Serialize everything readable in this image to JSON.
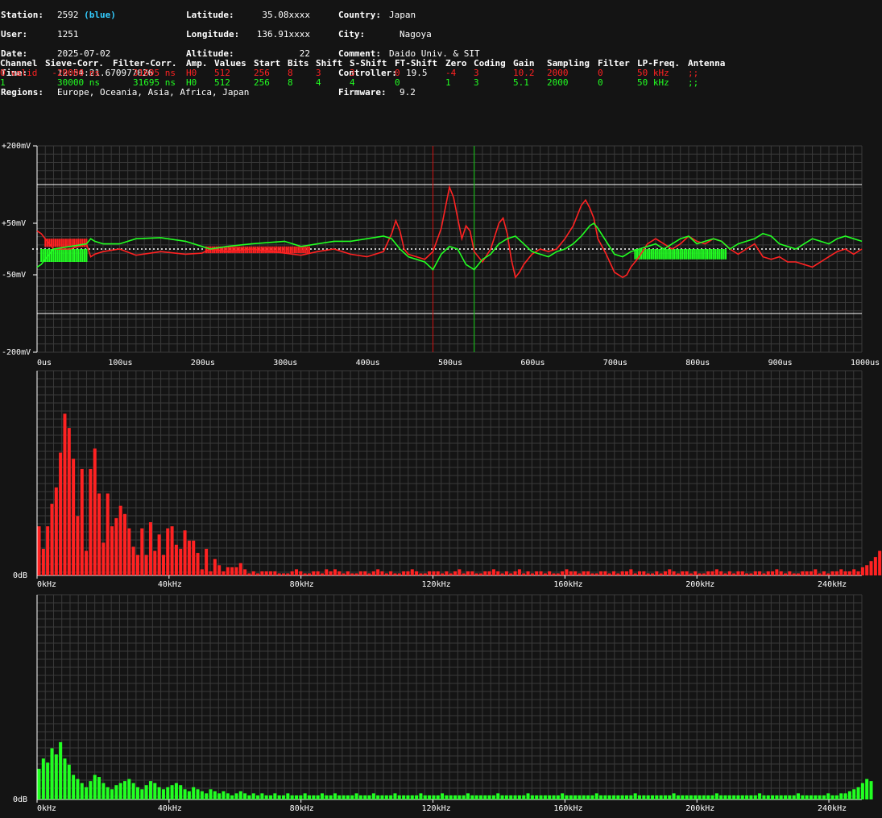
{
  "station_info": {
    "station_label": "Station:",
    "station": "2592",
    "station_color_name": "(blue)",
    "user_label": "User:",
    "user": "1251",
    "date_label": "Date:",
    "date": "2025-07-02",
    "time_label": "Time:",
    "time": "12:54:21.670977026",
    "regions_label": "Regions:",
    "regions": "Europe, Oceania, Asia, Africa, Japan",
    "latitude_label": "Latitude:",
    "latitude": "35.08xxxx",
    "longitude_label": "Longitude:",
    "longitude": "136.91xxxx",
    "altitude_label": "Altitude:",
    "altitude": "22",
    "country_label": "Country:",
    "country": "Japan",
    "city_label": "City:",
    "city": "Nagoya",
    "comment_label": "Comment:",
    "comment": "Daido Univ. & SIT",
    "controller_label": "Controller:",
    "controller": "19.5",
    "firmware_label": "Firmware:",
    "firmware": "9.2"
  },
  "channel_table": {
    "headers": [
      "Channel",
      "Sieve-Corr.",
      "Filter-Corr.",
      "Amp.",
      "Values",
      "Start",
      "Bits",
      "Shift",
      "S-Shift",
      "FT-Shift",
      "Zero",
      "Coding",
      "Gain",
      "Sampling",
      "Filter",
      "LP-Freq.",
      "Antenna"
    ],
    "rows": [
      [
        "0 valid",
        "-20000 ns",
        "31695 ns",
        "H0",
        "512",
        "256",
        "8",
        "3",
        "3",
        "0",
        "-4",
        "3",
        "10.2",
        "2000",
        "0",
        "50 kHz",
        ";;"
      ],
      [
        "1",
        "30000 ns",
        "31695 ns",
        "H0",
        "512",
        "256",
        "8",
        "4",
        "4",
        "0",
        "1",
        "3",
        "5.1",
        "2000",
        "0",
        "50 kHz",
        ";;"
      ]
    ],
    "row_colors": [
      "#ff2222",
      "#22ff22"
    ]
  },
  "chart_data": [
    {
      "type": "line",
      "xlim": [
        0,
        1000
      ],
      "ylim": [
        -200,
        200
      ],
      "y_tick_labels": [
        "+200mV",
        "+50mV",
        "-50mV",
        "-200mV"
      ],
      "y_tick_values": [
        200,
        50,
        -50,
        -200
      ],
      "x_tick_labels": [
        "0us",
        "100us",
        "200us",
        "300us",
        "400us",
        "500us",
        "600us",
        "700us",
        "800us",
        "900us",
        "1000us"
      ],
      "x_tick_values": [
        0,
        100,
        200,
        300,
        400,
        500,
        600,
        700,
        800,
        900,
        1000
      ],
      "reference_lines_mV": [
        125,
        -125
      ],
      "markers": [
        {
          "x": 480,
          "color": "#cc1111"
        },
        {
          "x": 530,
          "color": "#11cc11"
        }
      ],
      "series": [
        {
          "color": "#ff2222",
          "x": [
            0,
            5,
            10,
            20,
            40,
            60,
            65,
            70,
            80,
            100,
            120,
            150,
            180,
            200,
            210,
            230,
            260,
            300,
            320,
            340,
            360,
            380,
            400,
            420,
            430,
            435,
            440,
            445,
            450,
            460,
            470,
            480,
            490,
            500,
            505,
            510,
            515,
            520,
            525,
            530,
            540,
            550,
            560,
            565,
            570,
            575,
            580,
            585,
            590,
            600,
            610,
            620,
            630,
            640,
            650,
            660,
            665,
            670,
            675,
            680,
            690,
            700,
            710,
            715,
            720,
            730,
            740,
            750,
            760,
            770,
            780,
            790,
            800,
            810,
            820,
            830,
            840,
            850,
            860,
            870,
            880,
            890,
            900,
            910,
            920,
            930,
            940,
            950,
            960,
            970,
            980,
            990,
            1000
          ],
          "y": [
            35,
            30,
            20,
            0,
            0,
            10,
            -15,
            -10,
            -5,
            0,
            -12,
            -5,
            -10,
            -8,
            0,
            -5,
            0,
            -8,
            -12,
            -5,
            0,
            -10,
            -15,
            -5,
            30,
            55,
            35,
            0,
            -10,
            -15,
            -20,
            -5,
            40,
            120,
            100,
            60,
            20,
            45,
            35,
            -5,
            -25,
            0,
            50,
            60,
            30,
            -20,
            -55,
            -45,
            -30,
            -10,
            0,
            -5,
            0,
            20,
            45,
            85,
            95,
            80,
            60,
            20,
            -10,
            -45,
            -55,
            -50,
            -35,
            -15,
            10,
            20,
            10,
            0,
            10,
            25,
            15,
            10,
            20,
            15,
            0,
            -10,
            0,
            10,
            -15,
            -20,
            -15,
            -25,
            -25,
            -30,
            -35,
            -25,
            -15,
            -5,
            0,
            -10,
            0
          ]
        },
        {
          "color": "#22ff22",
          "x": [
            0,
            5,
            10,
            20,
            40,
            60,
            65,
            70,
            80,
            100,
            120,
            150,
            180,
            200,
            210,
            230,
            260,
            300,
            320,
            340,
            360,
            380,
            400,
            420,
            430,
            440,
            450,
            460,
            470,
            480,
            490,
            500,
            510,
            520,
            530,
            540,
            550,
            560,
            570,
            580,
            590,
            600,
            610,
            620,
            630,
            640,
            650,
            660,
            670,
            675,
            680,
            690,
            700,
            710,
            720,
            730,
            740,
            750,
            760,
            770,
            780,
            790,
            800,
            810,
            820,
            830,
            840,
            850,
            860,
            870,
            880,
            890,
            900,
            910,
            920,
            930,
            940,
            950,
            960,
            970,
            980,
            990,
            1000
          ],
          "y": [
            -35,
            -30,
            -20,
            0,
            5,
            10,
            20,
            15,
            10,
            10,
            20,
            22,
            15,
            5,
            0,
            5,
            10,
            15,
            5,
            10,
            15,
            15,
            20,
            25,
            20,
            0,
            -15,
            -20,
            -25,
            -40,
            -10,
            5,
            0,
            -30,
            -40,
            -20,
            -10,
            10,
            20,
            25,
            10,
            -5,
            -10,
            -15,
            -5,
            0,
            10,
            25,
            45,
            50,
            40,
            15,
            -10,
            -15,
            -5,
            0,
            5,
            10,
            0,
            10,
            20,
            25,
            10,
            15,
            20,
            15,
            0,
            10,
            15,
            20,
            30,
            25,
            10,
            5,
            0,
            10,
            20,
            15,
            10,
            20,
            25,
            20,
            15
          ]
        }
      ],
      "fill_regions": [
        {
          "series": 0,
          "x_start": 10,
          "x_end": 60,
          "y_min": 4,
          "y_max": 20,
          "color": "#ff2222"
        },
        {
          "series": 0,
          "x_start": 205,
          "x_end": 330,
          "y_min": -8,
          "y_max": 5,
          "color": "#ff2222"
        },
        {
          "series": 1,
          "x_start": 5,
          "x_end": 60,
          "y_min": -25,
          "y_max": 0,
          "color": "#22ff22"
        },
        {
          "series": 1,
          "x_start": 725,
          "x_end": 835,
          "y_min": -20,
          "y_max": 0,
          "color": "#22ff22"
        }
      ]
    },
    {
      "type": "bar",
      "color": "#ff2222",
      "y_tick_labels": [
        "0dB"
      ],
      "xlim": [
        0,
        250
      ],
      "x_tick_labels": [
        "0kHz",
        "40kHz",
        "80kHz",
        "120kHz",
        "160kHz",
        "200kHz",
        "240kHz"
      ],
      "x_tick_values": [
        0,
        40,
        80,
        120,
        160,
        200,
        240
      ],
      "bin_width_kHz": 1.3,
      "values": [
        24,
        13,
        24,
        35,
        43,
        60,
        79,
        72,
        57,
        29,
        52,
        12,
        52,
        62,
        40,
        16,
        40,
        24,
        28,
        34,
        30,
        23,
        14,
        10,
        23,
        10,
        26,
        12,
        20,
        10,
        23,
        24,
        15,
        13,
        22,
        17,
        17,
        11,
        3,
        13,
        2,
        8,
        5,
        2,
        4,
        4,
        4,
        6,
        3,
        1,
        2,
        1,
        2,
        2,
        2,
        2,
        1,
        1,
        1,
        2,
        3,
        2,
        1,
        1,
        2,
        2,
        1,
        3,
        2,
        3,
        2,
        1,
        2,
        1,
        1,
        2,
        2,
        1,
        2,
        3,
        2,
        1,
        2,
        1,
        1,
        2,
        2,
        3,
        2,
        1,
        1,
        2,
        2,
        2,
        1,
        2,
        1,
        2,
        3,
        1,
        2,
        2,
        1,
        1,
        2,
        2,
        3,
        2,
        1,
        2,
        1,
        2,
        3,
        1,
        2,
        1,
        2,
        2,
        1,
        2,
        1,
        1,
        2,
        3,
        2,
        2,
        1,
        2,
        2,
        1,
        1,
        2,
        2,
        1,
        2,
        1,
        2,
        2,
        3,
        1,
        2,
        2,
        1,
        1,
        2,
        1,
        2,
        3,
        2,
        1,
        2,
        2,
        1,
        2,
        1,
        1,
        2,
        2,
        3,
        2,
        1,
        2,
        1,
        2,
        2,
        1,
        1,
        2,
        2,
        1,
        2,
        2,
        3,
        2,
        1,
        2,
        1,
        1,
        2,
        2,
        2,
        3,
        1,
        2,
        1,
        2,
        2,
        3,
        2,
        2,
        3,
        2,
        4,
        5,
        7,
        9,
        12,
        11,
        8
      ],
      "ylim": [
        0,
        100
      ]
    },
    {
      "type": "bar",
      "color": "#22ff22",
      "y_tick_labels": [
        "0dB"
      ],
      "xlim": [
        0,
        250
      ],
      "x_tick_labels": [
        "0kHz",
        "40kHz",
        "80kHz",
        "120kHz",
        "160kHz",
        "200kHz",
        "240kHz"
      ],
      "x_tick_values": [
        0,
        40,
        80,
        120,
        160,
        200,
        240
      ],
      "bin_width_kHz": 1.3,
      "values": [
        15,
        20,
        18,
        25,
        22,
        28,
        20,
        17,
        12,
        10,
        8,
        6,
        9,
        12,
        11,
        8,
        6,
        5,
        7,
        8,
        9,
        10,
        8,
        6,
        5,
        7,
        9,
        8,
        6,
        5,
        6,
        7,
        8,
        7,
        5,
        4,
        6,
        5,
        4,
        3,
        5,
        4,
        3,
        4,
        3,
        2,
        3,
        4,
        3,
        2,
        3,
        2,
        3,
        2,
        2,
        3,
        2,
        2,
        3,
        2,
        2,
        2,
        3,
        2,
        2,
        2,
        3,
        2,
        2,
        3,
        2,
        2,
        2,
        2,
        3,
        2,
        2,
        2,
        3,
        2,
        2,
        2,
        2,
        3,
        2,
        2,
        2,
        2,
        2,
        3,
        2,
        2,
        2,
        2,
        3,
        2,
        2,
        2,
        2,
        2,
        3,
        2,
        2,
        2,
        2,
        2,
        2,
        3,
        2,
        2,
        2,
        2,
        2,
        2,
        3,
        2,
        2,
        2,
        2,
        2,
        2,
        2,
        3,
        2,
        2,
        2,
        2,
        2,
        2,
        2,
        3,
        2,
        2,
        2,
        2,
        2,
        2,
        2,
        2,
        3,
        2,
        2,
        2,
        2,
        2,
        2,
        2,
        2,
        3,
        2,
        2,
        2,
        2,
        2,
        2,
        2,
        2,
        2,
        3,
        2,
        2,
        2,
        2,
        2,
        2,
        2,
        2,
        2,
        3,
        2,
        2,
        2,
        2,
        2,
        2,
        2,
        2,
        3,
        2,
        2,
        2,
        2,
        2,
        2,
        3,
        2,
        2,
        3,
        3,
        4,
        5,
        6,
        8,
        10,
        9
      ],
      "ylim": [
        0,
        100
      ]
    }
  ]
}
